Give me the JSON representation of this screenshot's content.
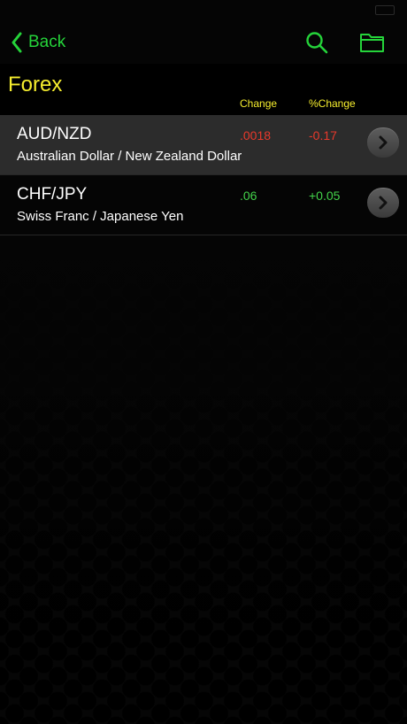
{
  "colors": {
    "accent_green": "#25d43a",
    "title_yellow": "#f6ee2e",
    "negative_red": "#e8392b",
    "positive_green": "#43d24a",
    "selected_row": "#2c2c2c"
  },
  "nav": {
    "back_label": "Back",
    "icons": [
      "chevron-left-icon",
      "search-icon",
      "folder-icon"
    ]
  },
  "section": {
    "title": "Forex",
    "columns": {
      "change": "Change",
      "pct_change": "%Change"
    }
  },
  "rows": [
    {
      "symbol": "AUD/NZD",
      "name": "Australian Dollar / New Zealand Dollar",
      "change": ".0018",
      "pct_change": "-0.17",
      "direction": "down",
      "selected": true
    },
    {
      "symbol": "CHF/JPY",
      "name": "Swiss Franc / Japanese Yen",
      "change": ".06",
      "pct_change": "+0.05",
      "direction": "up",
      "selected": false
    }
  ]
}
